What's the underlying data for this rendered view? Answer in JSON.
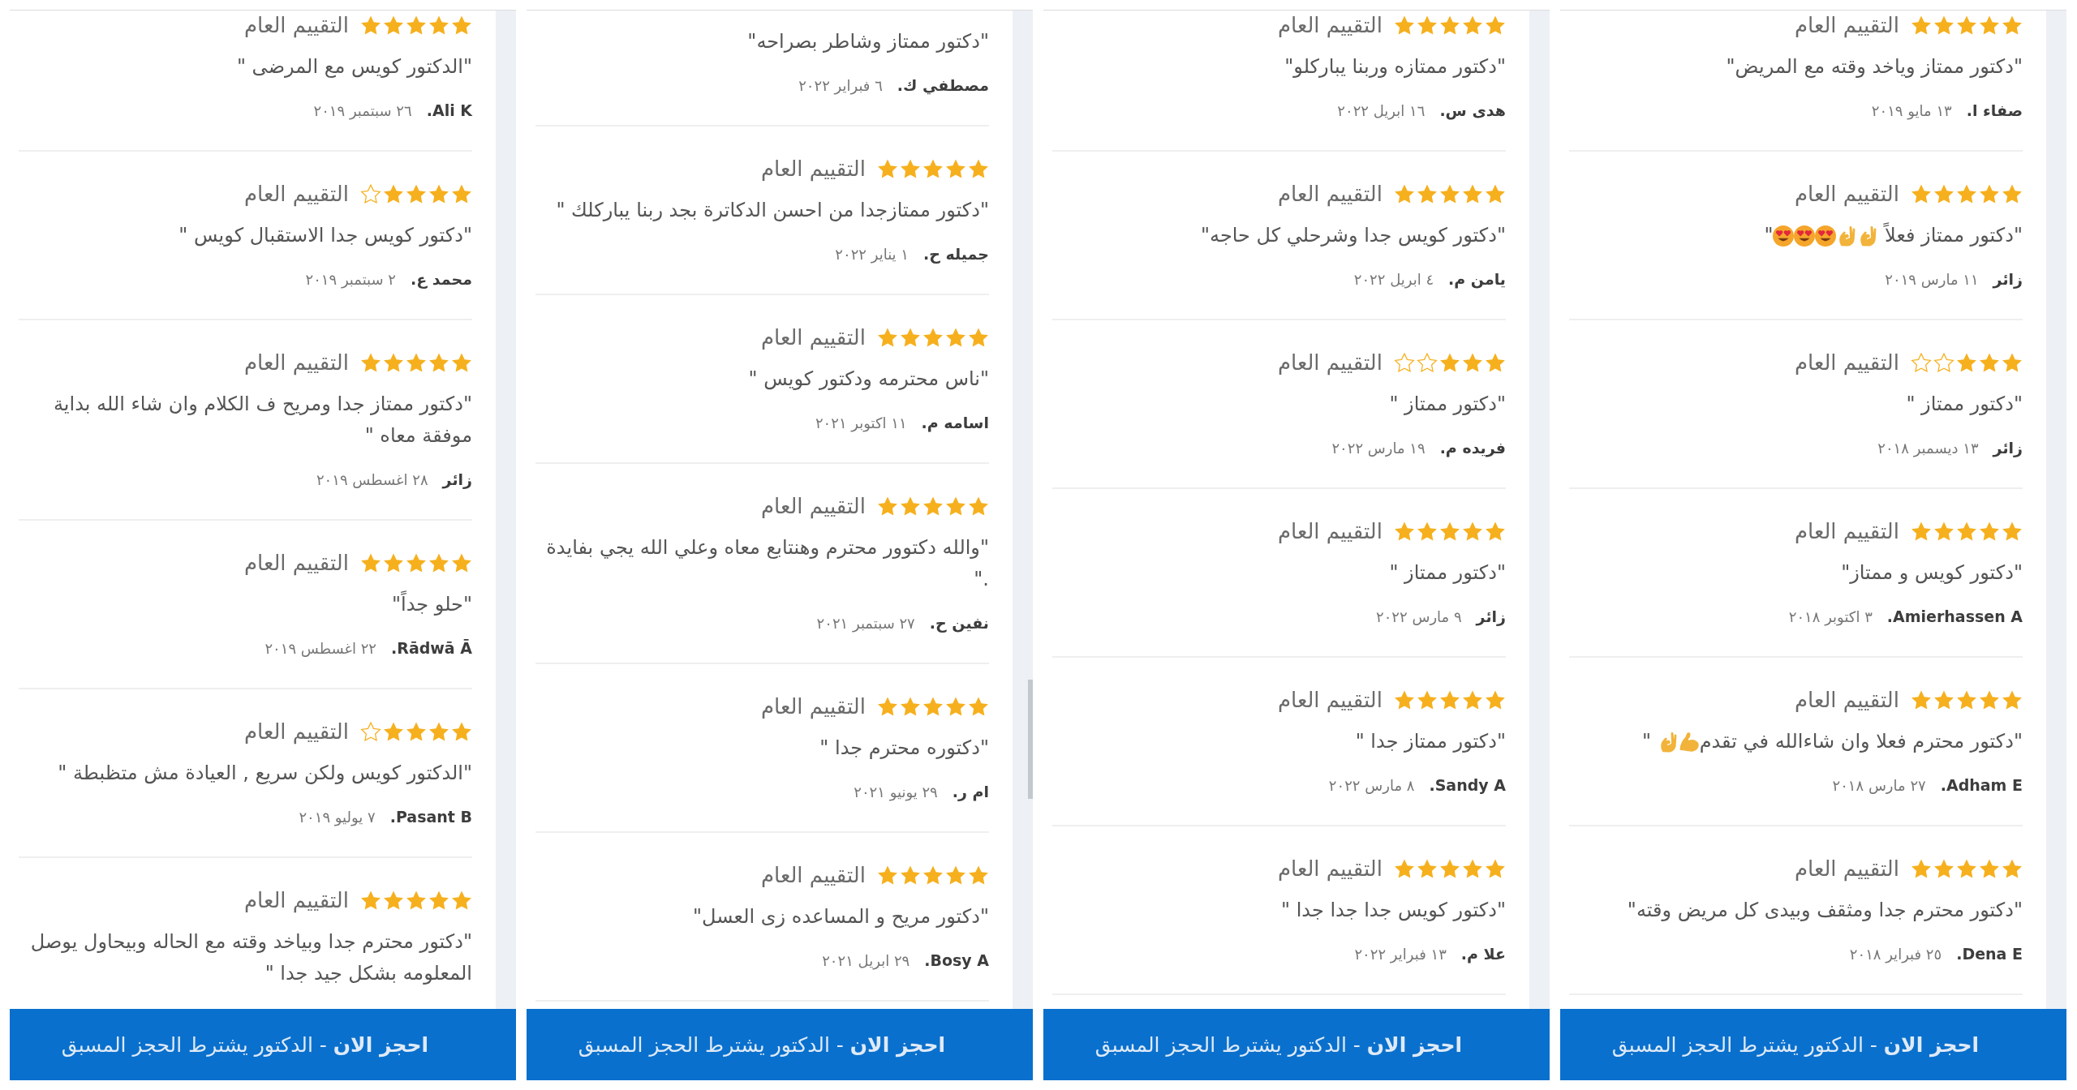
{
  "panels": [
    {
      "scroll_thumb": false,
      "reviews": [
        {
          "stars": 5,
          "rating_label": "التقييم العام",
          "quote": [
            {
              "kind": "text",
              "text": "\"دكتور ممتاز وياخد وقته مع المريض\""
            }
          ],
          "author": "صفاء ا.",
          "date": "١٣ مايو ٢٠١٩"
        },
        {
          "stars": 5,
          "rating_label": "التقييم العام",
          "quote": [
            {
              "kind": "text",
              "text": "\"دكتور ممتاز فعلاً "
            },
            {
              "kind": "okhand"
            },
            {
              "kind": "okhand"
            },
            {
              "kind": "hearteyes"
            },
            {
              "kind": "hearteyes"
            },
            {
              "kind": "hearteyes"
            },
            {
              "kind": "text",
              "text": "\""
            }
          ],
          "author": "زائر",
          "date": "١١ مارس ٢٠١٩"
        },
        {
          "stars": 3,
          "rating_label": "التقييم العام",
          "quote": [
            {
              "kind": "text",
              "text": "\"دكتور ممتاز \""
            }
          ],
          "author": "زائر",
          "date": "١٣ ديسمبر ٢٠١٨"
        },
        {
          "stars": 5,
          "rating_label": "التقييم العام",
          "quote": [
            {
              "kind": "text",
              "text": "\"دكتور كويس و ممتاز\""
            }
          ],
          "author": "Amierhassen A.",
          "date": "٣ اكتوبر ٢٠١٨"
        },
        {
          "stars": 5,
          "rating_label": "التقييم العام",
          "quote": [
            {
              "kind": "text",
              "text": "\"دكتور محترم فعلا وان شاءالله في تقدم"
            },
            {
              "kind": "biceps"
            },
            {
              "kind": "okhand"
            },
            {
              "kind": "text",
              "text": " \""
            }
          ],
          "author": "Adham E.",
          "date": "٢٧ مارس ٢٠١٨"
        },
        {
          "stars": 5,
          "rating_label": "التقييم العام",
          "quote": [
            {
              "kind": "text",
              "text": "\"دكتور محترم جدا ومثقف وبيدى كل مريض وقته\""
            }
          ],
          "author": "Dena E.",
          "date": "٢٥ فبراير ٢٠١٨"
        }
      ],
      "book_button": "**احجز الان** - الدكتور يشترط الحجز المسبق"
    },
    {
      "scroll_thumb": false,
      "reviews": [
        {
          "stars": 5,
          "rating_label": "التقييم العام",
          "quote": [
            {
              "kind": "text",
              "text": "\"دكتور ممتازه وربنا يباركلو\""
            }
          ],
          "author": "هدى س.",
          "date": "١٦ ابريل ٢٠٢٢"
        },
        {
          "stars": 5,
          "rating_label": "التقييم العام",
          "quote": [
            {
              "kind": "text",
              "text": "\"دكتور كويس جدا وشرحلي كل حاجه\""
            }
          ],
          "author": "يامن م.",
          "date": "٤ ابريل ٢٠٢٢"
        },
        {
          "stars": 3,
          "rating_label": "التقييم العام",
          "quote": [
            {
              "kind": "text",
              "text": "\"دكتور ممتاز \""
            }
          ],
          "author": "فريده م.",
          "date": "١٩ مارس ٢٠٢٢"
        },
        {
          "stars": 5,
          "rating_label": "التقييم العام",
          "quote": [
            {
              "kind": "text",
              "text": "\"دكتور ممتاز \""
            }
          ],
          "author": "زائر",
          "date": "٩ مارس ٢٠٢٢"
        },
        {
          "stars": 5,
          "rating_label": "التقييم العام",
          "quote": [
            {
              "kind": "text",
              "text": "\"دكتور ممتاز جدا \""
            }
          ],
          "author": "Sandy A.",
          "date": "٨ مارس ٢٠٢٢"
        },
        {
          "stars": 5,
          "rating_label": "التقييم العام",
          "quote": [
            {
              "kind": "text",
              "text": "\"دكتور كويس جدا جدا جدا \""
            }
          ],
          "author": "علا م.",
          "date": "١٣ فبراير ٢٠٢٢"
        }
      ],
      "book_button": "**احجز الان** - الدكتور يشترط الحجز المسبق"
    },
    {
      "scroll_thumb": true,
      "reviews": [
        {
          "quote": [
            {
              "kind": "text",
              "text": "\"دكتور ممتاز وشاطر بصراحه\""
            }
          ],
          "author": "مصطفي ك.",
          "date": "٦ فبراير ٢٠٢٢"
        },
        {
          "stars": 5,
          "rating_label": "التقييم العام",
          "quote": [
            {
              "kind": "text",
              "text": "\"دكتور ممتازجدا من احسن الدكاترة بجد ربنا يباركلك \""
            }
          ],
          "author": "جميله ح.",
          "date": "١ يناير ٢٠٢٢"
        },
        {
          "stars": 5,
          "rating_label": "التقييم العام",
          "quote": [
            {
              "kind": "text",
              "text": "\"ناس محترمه ودكتور كويس \""
            }
          ],
          "author": "اسامه م.",
          "date": "١١ اكتوبر ٢٠٢١"
        },
        {
          "stars": 5,
          "rating_label": "التقييم العام",
          "quote": [
            {
              "kind": "text",
              "text": "\"والله دكتوور محترم وهنتابع معاه وعلي الله يجي بفايدة .\""
            }
          ],
          "author": "نفين ح.",
          "date": "٢٧ سبتمبر ٢٠٢١"
        },
        {
          "stars": 5,
          "rating_label": "التقييم العام",
          "quote": [
            {
              "kind": "text",
              "text": "\"دكتوره محترم جدا \""
            }
          ],
          "author": "ام ر.",
          "date": "٢٩ يونيو ٢٠٢١"
        },
        {
          "stars": 5,
          "rating_label": "التقييم العام",
          "quote": [
            {
              "kind": "text",
              "text": "\"دكتور مريح و المساعده زى العسل\""
            }
          ],
          "author": "Bosy A.",
          "date": "٢٩ ابريل ٢٠٢١"
        }
      ],
      "book_button": "**احجز الان** - الدكتور يشترط الحجز المسبق"
    },
    {
      "scroll_thumb": false,
      "reviews": [
        {
          "stars": 5,
          "rating_label": "التقييم العام",
          "quote": [
            {
              "kind": "text",
              "text": "\"الدكتور كويس مع المرضى \""
            }
          ],
          "author": "Ali K.",
          "date": "٢٦ سبتمبر ٢٠١٩"
        },
        {
          "stars": 4,
          "rating_label": "التقييم العام",
          "quote": [
            {
              "kind": "text",
              "text": "\"دكتور كويس جدا الاستقبال كويس \""
            }
          ],
          "author": "محمد ع.",
          "date": "٢ سبتمبر ٢٠١٩"
        },
        {
          "stars": 5,
          "rating_label": "التقييم العام",
          "quote": [
            {
              "kind": "text",
              "text": "\"دكتور ممتاز جدا ومريح ف الكلام وان شاء الله بداية موفقة معاه \""
            }
          ],
          "author": "زائر",
          "date": "٢٨ اغسطس ٢٠١٩"
        },
        {
          "stars": 5,
          "rating_label": "التقييم العام",
          "quote": [
            {
              "kind": "text",
              "text": "\"حلو جداً\""
            }
          ],
          "author": "Rādwā Ā.",
          "date": "٢٢ اغسطس ٢٠١٩"
        },
        {
          "stars": 4,
          "rating_label": "التقييم العام",
          "quote": [
            {
              "kind": "text",
              "text": "\"الدكتور كويس ولكن سريع , العيادة مش متظبطة \""
            }
          ],
          "author": "Pasant B.",
          "date": "٧ يوليو ٢٠١٩"
        },
        {
          "stars": 5,
          "rating_label": "التقييم العام",
          "quote": [
            {
              "kind": "text",
              "text": "\"دكتور محترم جدا وبياخد وقته مع الحاله وبيحاول يوصل المعلومه بشكل جيد جدا \""
            }
          ]
        }
      ],
      "book_button": "**احجز الان** - الدكتور يشترط الحجز المسبق"
    }
  ]
}
